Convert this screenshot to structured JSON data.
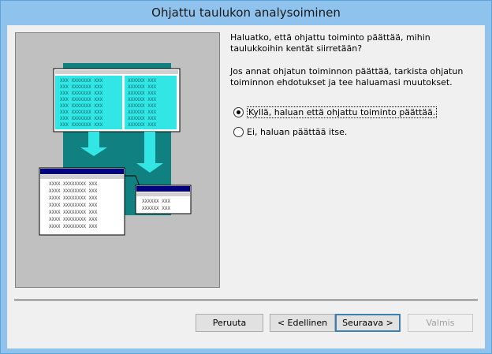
{
  "window": {
    "title": "Ohjattu taulukon analysoiminen"
  },
  "question": "Haluatko, että ohjattu toiminto päättää, mihin taulukkoihin kentät siirretään?",
  "info": "Jos annat ohjatun toiminnon päättää, tarkista ohjatun toiminnon ehdotukset ja tee haluamasi muutokset.",
  "options": [
    {
      "label": "Kyllä, haluan että ohjattu toiminto päättää.",
      "checked": true
    },
    {
      "label": "Ei, haluan päättää itse.",
      "checked": false
    }
  ],
  "buttons": {
    "cancel": "Peruuta",
    "back": "< Edellinen",
    "next": "Seuraava >",
    "finish": "Valmis"
  },
  "colors": {
    "cyan": "#33e6e6",
    "teal": "#108080",
    "navy": "#000080"
  }
}
